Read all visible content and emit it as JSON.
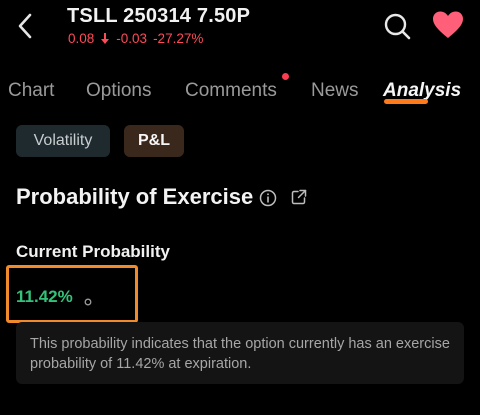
{
  "header": {
    "title": "TSLL 250314 7.50P",
    "price": "0.08",
    "change": "-0.03",
    "change_pct": "-27.27%",
    "accent_red": "#ff4a57",
    "heart_color": "#ff5f78",
    "icons": [
      "back-chevron-icon",
      "search-icon",
      "heart-icon"
    ]
  },
  "tabs": [
    {
      "label": "Chart",
      "active": false
    },
    {
      "label": "Options",
      "active": false
    },
    {
      "label": "Comments",
      "active": false,
      "badge": true
    },
    {
      "label": "News",
      "active": false
    },
    {
      "label": "Analysis",
      "active": true
    }
  ],
  "chips": {
    "volatility": "Volatility",
    "pl": "P&L"
  },
  "section": {
    "title": "Probability of Exercise",
    "icons": [
      "info-icon",
      "share-icon"
    ]
  },
  "probability": {
    "label": "Current Probability",
    "value": "11.42%",
    "value_color": "#33c27a",
    "description": "This probability indicates that the option currently has an exercise probability of 11.42% at expiration."
  },
  "highlight_color": "#f08a2b"
}
